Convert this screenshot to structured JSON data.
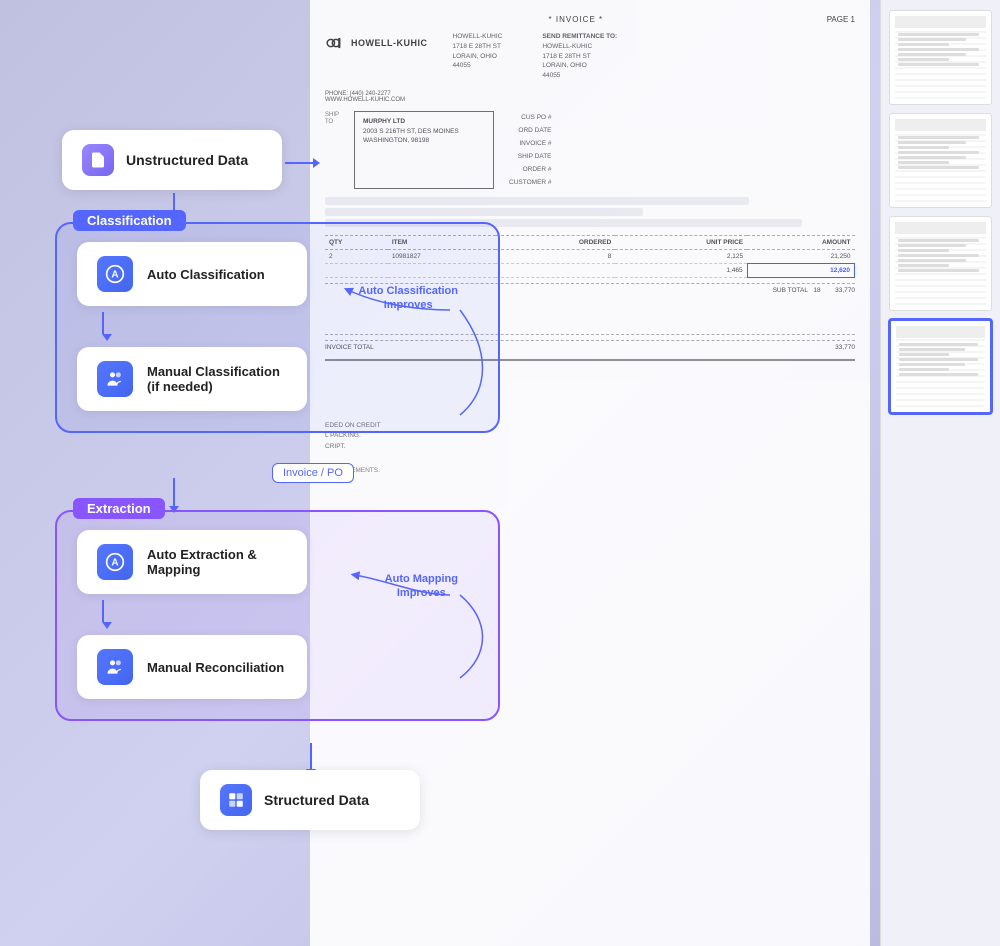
{
  "background_color": "#c8c8e8",
  "invoice": {
    "title": "* INVOICE *",
    "page_label": "PAGE 1",
    "company": {
      "name": "HOWELL-KUHIC",
      "address_line1": "1718 E 28TH ST",
      "address_line2": "LORAIN, OHIO",
      "address_line3": "44055",
      "phone": "PHONE: (440) 240-2277",
      "website": "WWW.HOWELL-KUHIC.COM"
    },
    "remit_to": {
      "label": "SEND REMITTANCE TO:",
      "name": "HOWELL-KUHIC",
      "address_line1": "1718 E 28TH ST",
      "address_line2": "LORAIN, OHIO",
      "address_line3": "44055"
    },
    "howell_kuhic_label": "HOWELL-KUHIC",
    "ship_to": {
      "label": "SHIP TO",
      "company": "MURPHY LTD",
      "address": "2003 S 216TH ST, DES MOINES",
      "city_state": "WASHINGTON, 98198"
    },
    "fields": {
      "cus_po": "CUS PO #",
      "ord_date": "ORD DATE",
      "invoice_num": "INVOICE #",
      "ship_date": "SHIP DATE",
      "order_num": "ORDER #",
      "customer_num": "CUSTOMER #"
    },
    "table_headers": [
      "QTY",
      "ITEM",
      "ORDERED",
      "UNIT PRICE",
      "AMOUNT"
    ],
    "rows": [
      {
        "qty": "2",
        "item": "10981827",
        "ordered": "8",
        "unit_price": "2,125",
        "amount": "21,250"
      },
      {
        "qty": "",
        "item": "",
        "ordered": "",
        "unit_price": "1,465",
        "amount": "12,620",
        "highlighted": true
      }
    ],
    "subtotal_label": "SUB TOTAL",
    "subtotal_qty": "18",
    "subtotal_amount": "33,770",
    "invoice_total_label": "INVOICE TOTAL",
    "invoice_total_amount": "33,770",
    "notes": "EDED ON CREDIT\nL PACKING.\nCRIPT."
  },
  "flow": {
    "unstructured_data": {
      "label": "Unstructured Data",
      "icon": "📄"
    },
    "classification_section": {
      "label": "Classification",
      "auto_classification": {
        "label": "Auto Classification",
        "icon": "A"
      },
      "manual_classification": {
        "label": "Manual Classification (if needed)",
        "icon": "👥"
      },
      "improves_label": "Auto Classification\nImproves"
    },
    "invoice_po_badge": "Invoice / PO",
    "extraction_section": {
      "label": "Extraction",
      "auto_extraction": {
        "label": "Auto Extraction & Mapping",
        "icon": "A"
      },
      "manual_reconciliation": {
        "label": "Manual Reconciliation",
        "icon": "👥"
      },
      "improves_label": "Auto Mapping\nImproves"
    },
    "structured_data": {
      "label": "Structured Data",
      "icon": "📊"
    }
  },
  "thumbnails": [
    {
      "id": 1,
      "active": false
    },
    {
      "id": 2,
      "active": false
    },
    {
      "id": 3,
      "active": false
    },
    {
      "id": 4,
      "active": true
    }
  ]
}
